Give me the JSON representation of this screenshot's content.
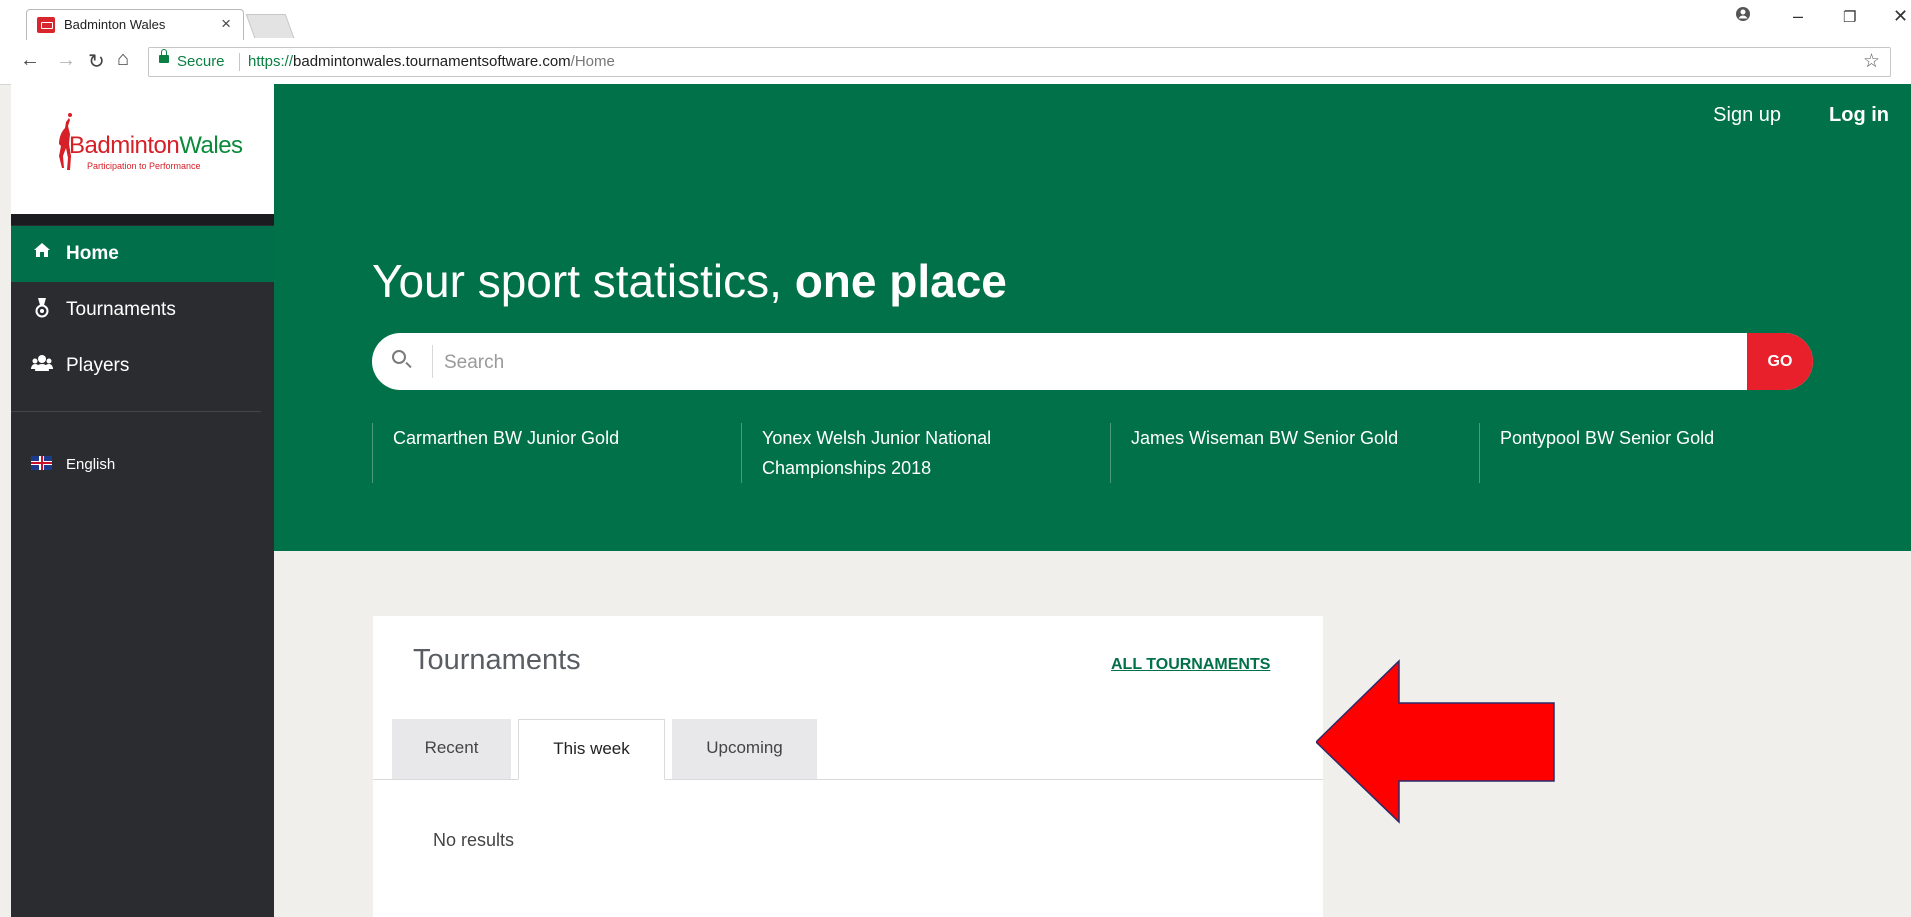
{
  "browser": {
    "tab_title": "Badminton Wales",
    "tab_close": "×",
    "url_scheme": "https://",
    "url_host": "badmintonwales.tournamentsoftware.com",
    "url_path": "/Home",
    "secure_label": "Secure",
    "nav_icons": [
      "back-icon",
      "forward-icon",
      "reload-icon",
      "home-icon"
    ],
    "window_controls": [
      "account-icon",
      "minimize-icon",
      "restore-icon",
      "close-icon"
    ]
  },
  "logo": {
    "brand_part1": "Badminton",
    "brand_part2": "Wales",
    "tagline": "Participation to Performance",
    "red": "#d61f26",
    "green": "#0a8a3a"
  },
  "sidebar": {
    "items": [
      {
        "label": "Home",
        "icon": "home-icon",
        "active": true
      },
      {
        "label": "Tournaments",
        "icon": "medal-icon",
        "active": false
      },
      {
        "label": "Players",
        "icon": "players-icon",
        "active": false
      }
    ],
    "language": {
      "label": "English",
      "icon": "uk-flag-icon"
    }
  },
  "header": {
    "signup": "Sign up",
    "login": "Log in"
  },
  "hero": {
    "title_regular": "Your sport statistics,",
    "title_bold": "one place",
    "search_placeholder": "Search",
    "go_label": "GO",
    "featured": [
      "Carmarthen BW Junior Gold",
      "Yonex Welsh Junior National Championships 2018",
      "James Wiseman BW Senior Gold",
      "Pontypool BW Senior Gold"
    ]
  },
  "tournaments": {
    "title": "Tournaments",
    "all_link": "ALL TOURNAMENTS",
    "tabs": [
      "Recent",
      "This week",
      "Upcoming"
    ],
    "active_tab": "This week",
    "empty_text": "No results"
  },
  "colors": {
    "primary_green": "#017149",
    "sidebar_dark": "#2b2c30",
    "go_red": "#e8202c",
    "annotation_arrow": "#ff0000"
  }
}
